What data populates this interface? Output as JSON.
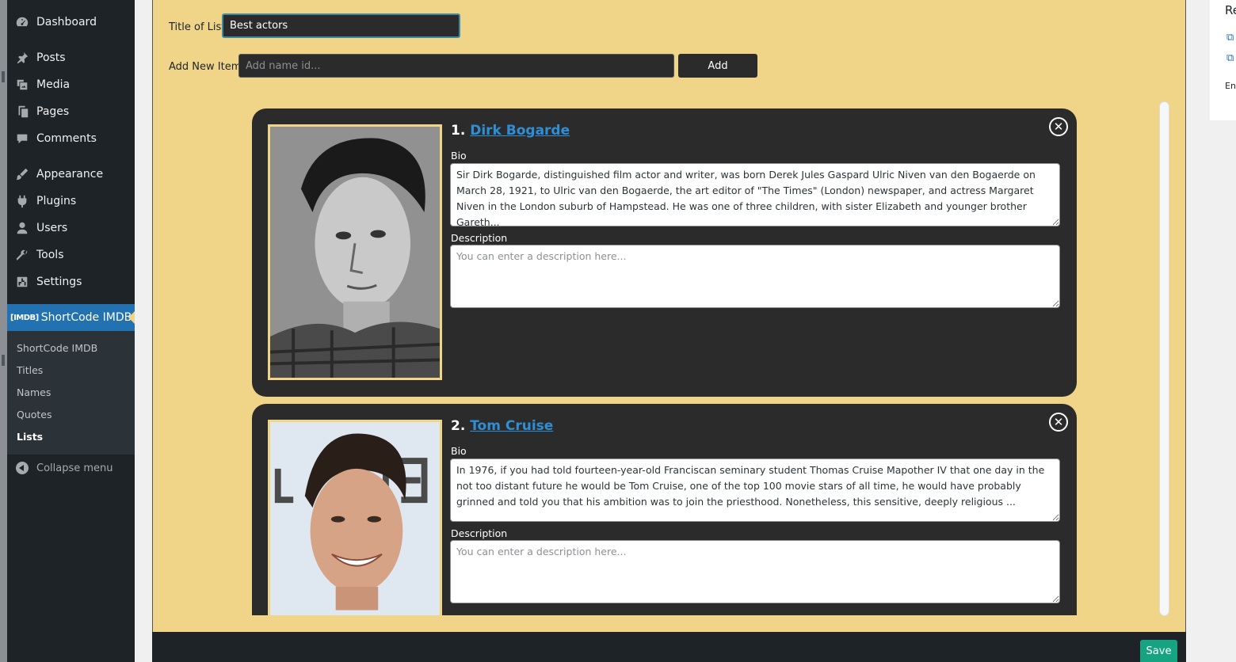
{
  "sidebar": {
    "items": [
      {
        "label": "Dashboard",
        "icon": "dashboard-icon"
      },
      {
        "label": "Posts",
        "icon": "pin-icon"
      },
      {
        "label": "Media",
        "icon": "media-icon"
      },
      {
        "label": "Pages",
        "icon": "pages-icon"
      },
      {
        "label": "Comments",
        "icon": "comments-icon"
      },
      {
        "label": "Appearance",
        "icon": "brush-icon"
      },
      {
        "label": "Plugins",
        "icon": "plugin-icon"
      },
      {
        "label": "Users",
        "icon": "user-icon"
      },
      {
        "label": "Tools",
        "icon": "wrench-icon"
      },
      {
        "label": "Settings",
        "icon": "settings-icon"
      }
    ],
    "active_item": {
      "tag": "[IMDB]",
      "label": "ShortCode IMDB"
    },
    "submenu": [
      "ShortCode IMDB",
      "Titles",
      "Names",
      "Quotes",
      "Lists"
    ],
    "current_submenu": "Lists",
    "collapse_label": "Collapse menu"
  },
  "form": {
    "title_label": "Title of List",
    "title_value": "Best actors",
    "add_label": "Add New Item",
    "add_placeholder": "Add name id...",
    "add_button": "Add"
  },
  "cards": [
    {
      "number": "1.",
      "name": "Dirk Bogarde",
      "bio_label": "Bio",
      "bio": "Sir Dirk Bogarde, distinguished film actor and writer, was born Derek Jules Gaspard Ulric Niven van den Bogaerde on March 28, 1921, to Ulric van den Bogaerde, the art editor of \"The Times\" (London) newspaper, and actress Margaret Niven in the London suburb of Hampstead. He was one of three children, with sister Elizabeth and younger brother Gareth...",
      "description_label": "Description",
      "description_placeholder": "You can enter a description here..."
    },
    {
      "number": "2.",
      "name": "Tom Cruise",
      "bio_label": "Bio",
      "bio": "In 1976, if you had told fourteen-year-old Franciscan seminary student Thomas Cruise Mapother IV that one day in the not too distant future he would be Tom Cruise, one of the top 100 movie stars of all time, he would have probably grinned and told you that his ambition was to join the priesthood. Nonetheless, this sensitive, deeply religious ...",
      "description_label": "Description",
      "description_placeholder": "You can enter a description here..."
    }
  ],
  "footer": {
    "save_label": "Save"
  },
  "right_panel": {
    "title": "Re",
    "footer_text": "En"
  },
  "colors": {
    "panel": "#f0d487",
    "card": "#2b2b2b",
    "accent": "#2271b1",
    "link": "#2e8fd6",
    "save": "#15a382"
  }
}
